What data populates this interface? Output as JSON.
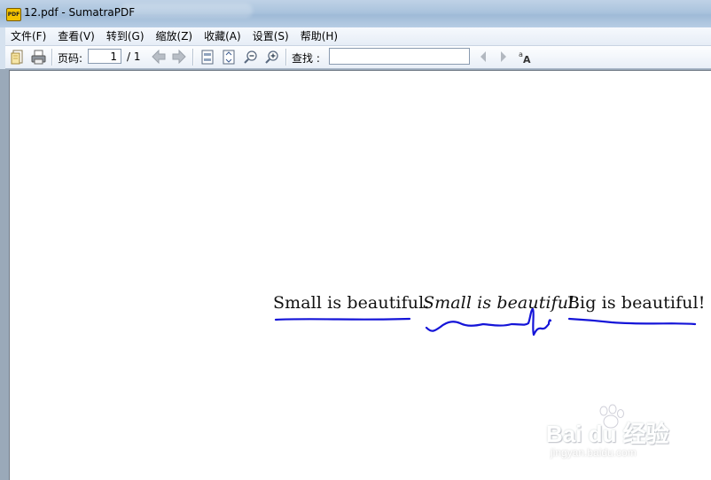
{
  "window": {
    "title": "12.pdf - SumatraPDF",
    "app_icon_text": "PDF"
  },
  "menu": {
    "items": [
      {
        "label": "文件(F)"
      },
      {
        "label": "查看(V)"
      },
      {
        "label": "转到(G)"
      },
      {
        "label": "缩放(Z)"
      },
      {
        "label": "收藏(A)"
      },
      {
        "label": "设置(S)"
      },
      {
        "label": "帮助(H)"
      }
    ]
  },
  "toolbar": {
    "page_label": "页码:",
    "page_value": "1",
    "page_total": "/ 1",
    "find_label": "查找 :",
    "find_value": "",
    "icons": {
      "open": "open-folder-icon",
      "print": "printer-icon",
      "prev_page": "arrow-left-icon",
      "next_page": "arrow-right-icon",
      "fit_page": "fit-page-icon",
      "fit_width": "fit-width-icon",
      "zoom_out": "zoom-out-icon",
      "zoom_in": "zoom-in-icon",
      "find_prev": "triangle-left-icon",
      "find_next": "triangle-right-icon",
      "match_case": "match-case-icon"
    }
  },
  "document": {
    "text_regular": "Small is beautiful.",
    "text_italic": "Small is beautiful.",
    "text_big": "Big is beautiful!",
    "ink_color": "#1414d8"
  },
  "watermark": {
    "main": "Bai du 经验",
    "sub": "jingyan.baidu.com"
  }
}
